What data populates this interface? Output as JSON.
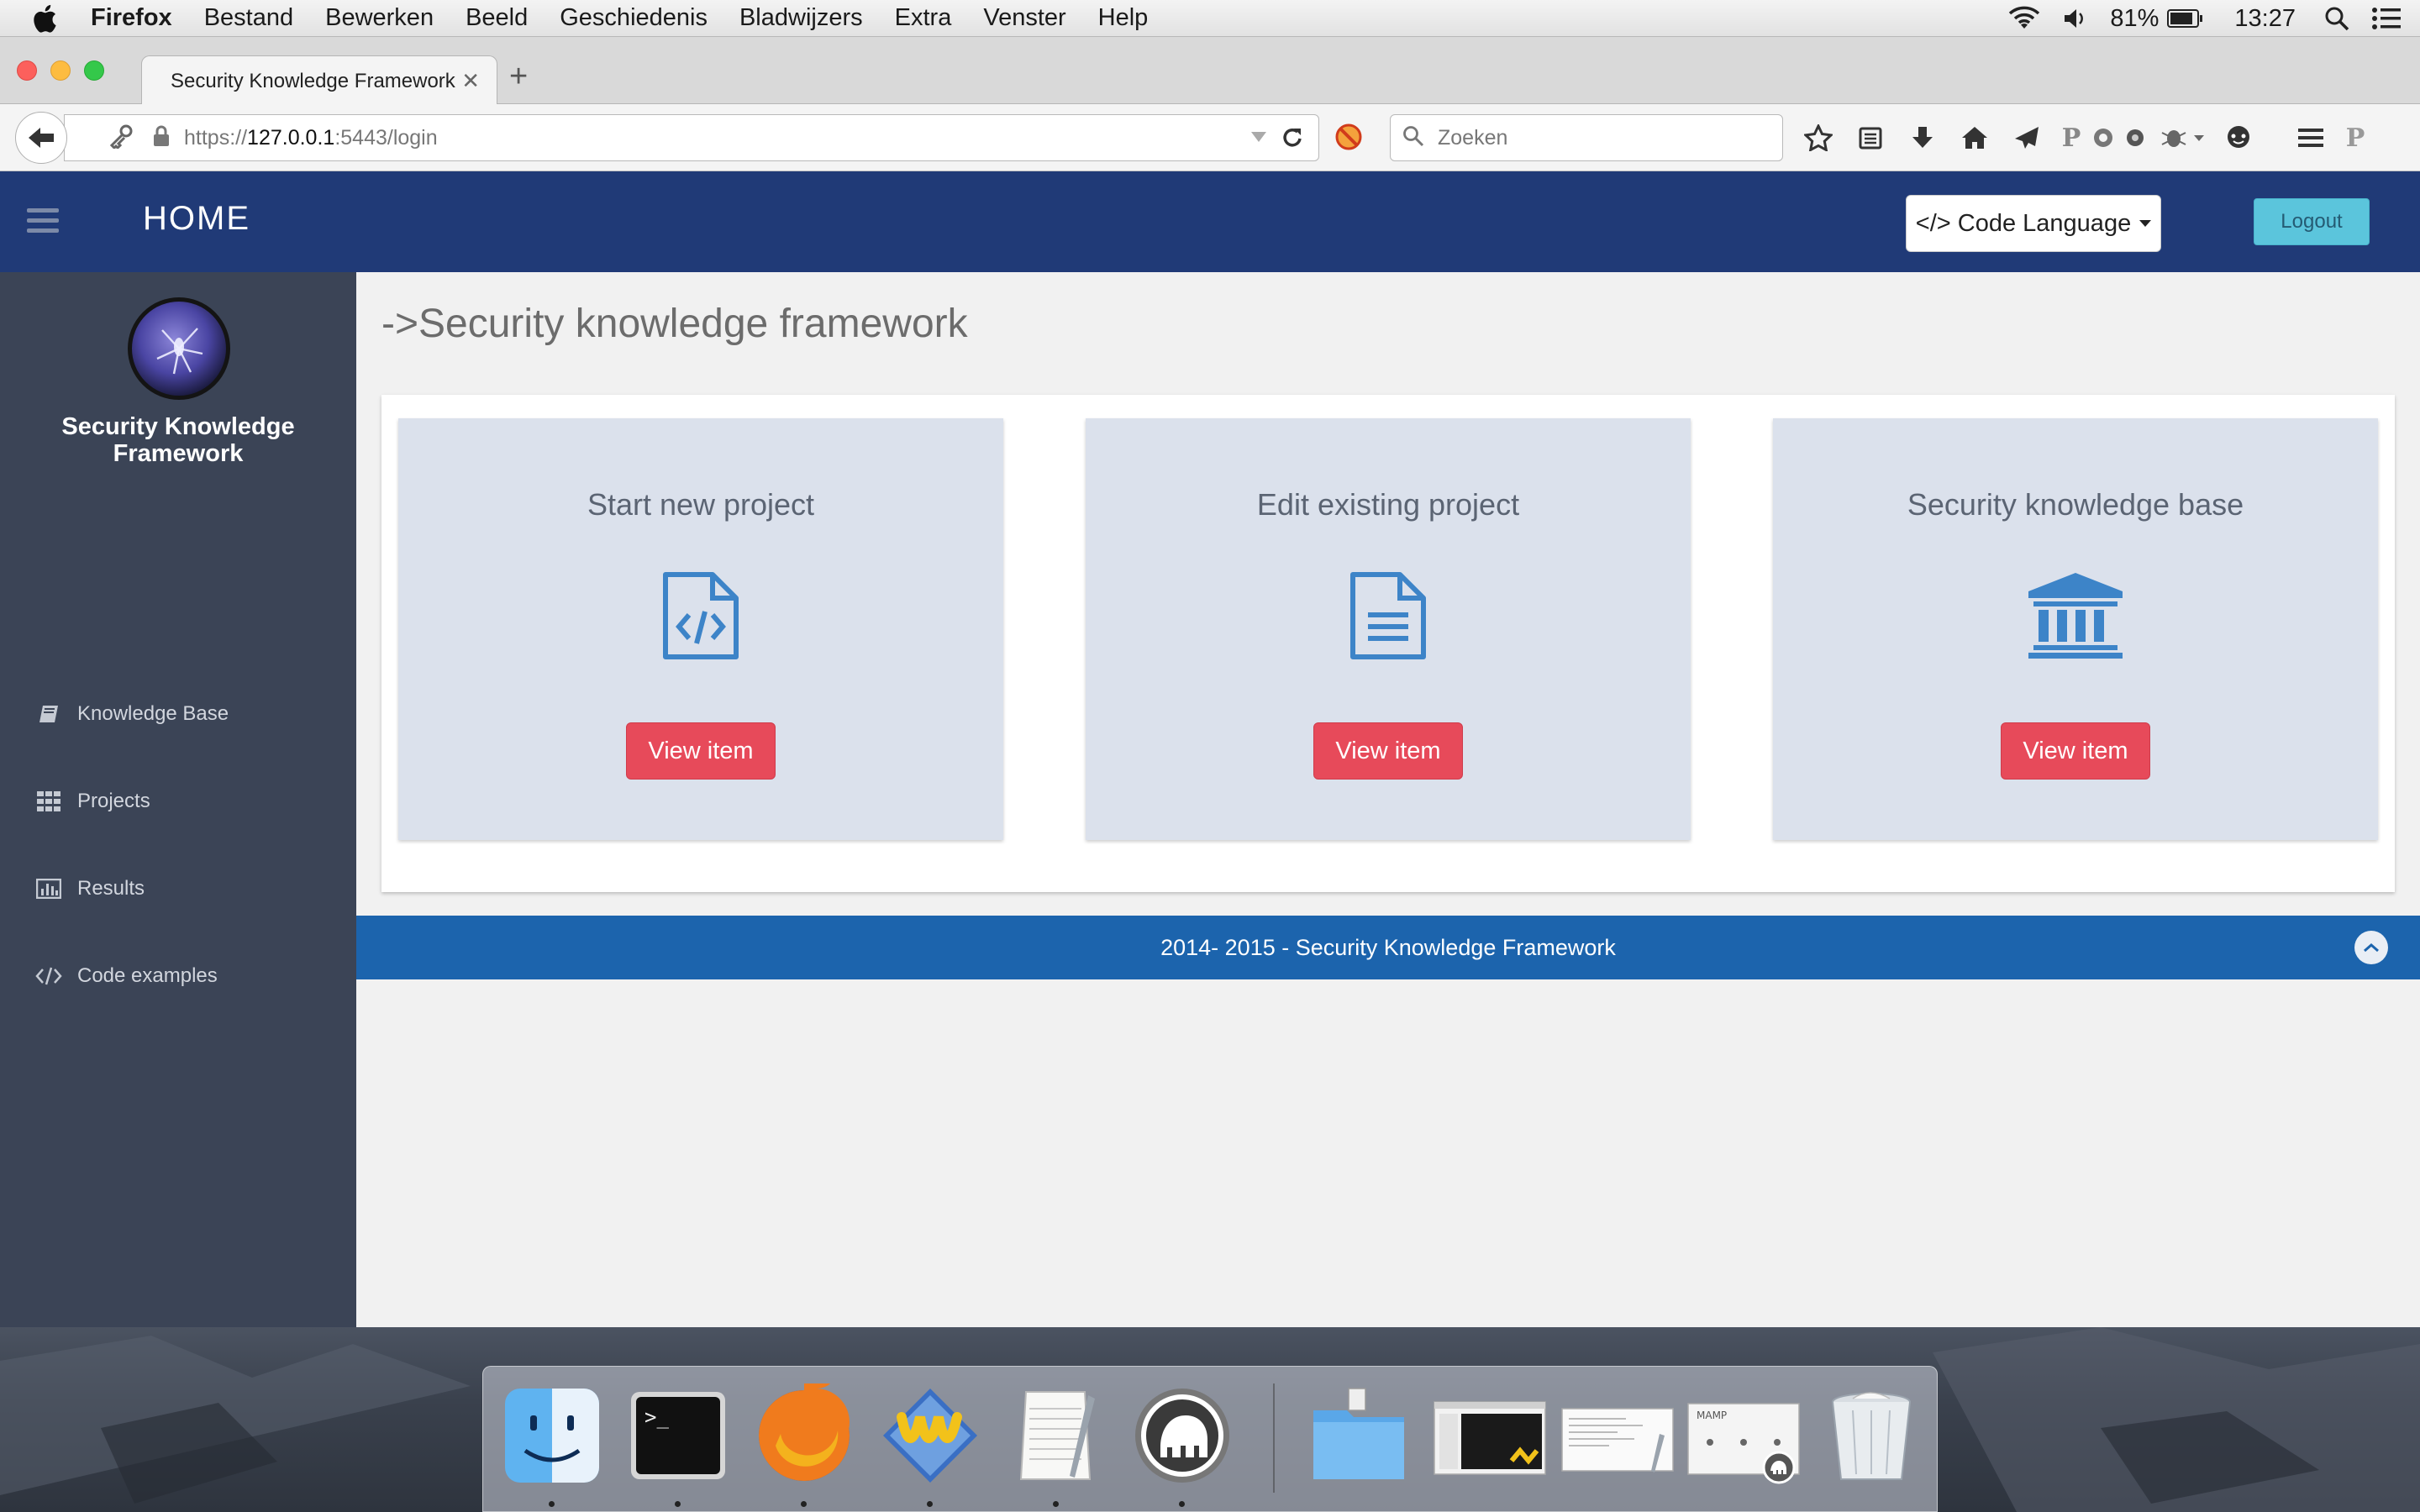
{
  "menubar": {
    "app_name": "Firefox",
    "menus": [
      "Bestand",
      "Bewerken",
      "Beeld",
      "Geschiedenis",
      "Bladwijzers",
      "Extra",
      "Venster",
      "Help"
    ],
    "battery": "81%",
    "clock": "13:27"
  },
  "browser": {
    "tab_title": "Security Knowledge Framework",
    "tab_close": "✕",
    "new_tab": "+",
    "url_prefix": "https://",
    "url_host": "127.0.0.1",
    "url_rest": ":5443/login",
    "search_placeholder": "Zoeken"
  },
  "topbar": {
    "title": "HOME",
    "code_language_label": "</> Code Language",
    "logout_label": "Logout"
  },
  "sidebar": {
    "app_title": "Security Knowledge Framework",
    "items": [
      {
        "label": "Knowledge Base",
        "icon": "book-icon"
      },
      {
        "label": "Projects",
        "icon": "grid-icon"
      },
      {
        "label": "Results",
        "icon": "bar-chart-icon"
      },
      {
        "label": "Code examples",
        "icon": "code-icon"
      }
    ]
  },
  "main": {
    "heading": "->Security knowledge framework",
    "cards": [
      {
        "title": "Start new project",
        "icon": "file-code-icon",
        "button": "View item"
      },
      {
        "title": "Edit existing project",
        "icon": "file-text-icon",
        "button": "View item"
      },
      {
        "title": "Security knowledge base",
        "icon": "bank-icon",
        "button": "View item"
      }
    ]
  },
  "footer": {
    "text": "2014- 2015 - Security Knowledge Framework"
  },
  "dock": {
    "apps": [
      "finder-icon",
      "terminal-icon",
      "firefox-icon",
      "wireshark-icon",
      "textedit-icon",
      "mamp-icon"
    ],
    "stacks": [
      "folder-icon",
      "window-thumbnail-icon",
      "document-thumbnail-icon",
      "mamp-window-icon",
      "trash-icon"
    ]
  },
  "colors": {
    "topbar": "#203a77",
    "sidebar": "#3b4456",
    "card": "#dbe1ec",
    "button": "#e74a5a",
    "footer": "#1c64ad",
    "icon_blue": "#3d84c8",
    "logout": "#5bc5dc"
  }
}
